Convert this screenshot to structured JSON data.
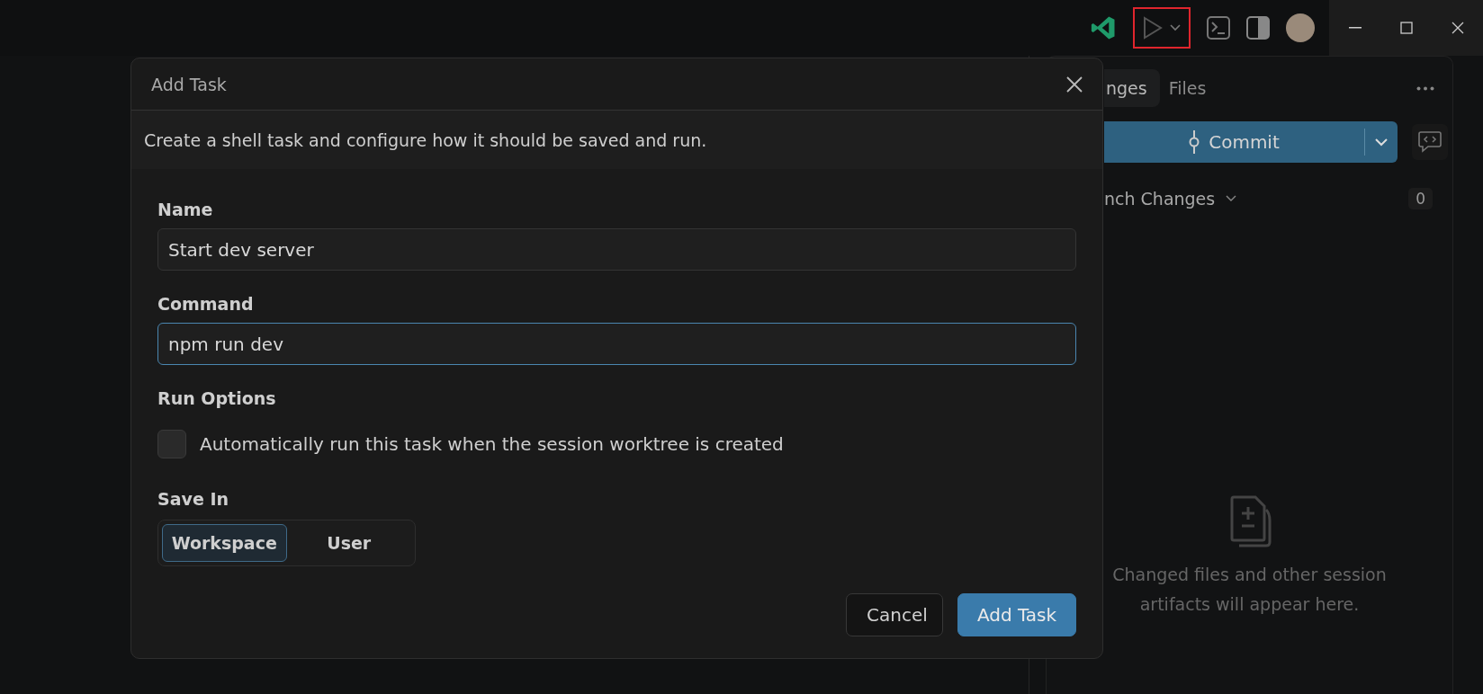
{
  "titlebar": {
    "run_button": {
      "annotated": true
    }
  },
  "panel": {
    "tabs": [
      {
        "label": "nges",
        "selected": true
      },
      {
        "label": "Files",
        "selected": false
      }
    ],
    "commit_button": {
      "label": "Commit"
    },
    "section": {
      "label": "nch Changes",
      "count": "0",
      "expanded": true
    },
    "empty_state": {
      "text": "Changed files and other session artifacts will appear here."
    }
  },
  "dialog": {
    "title": "Add Task",
    "description": "Create a shell task and configure how it should be saved and run.",
    "fields": [
      {
        "label": "Name",
        "value": "Start dev server",
        "focused": false
      },
      {
        "label": "Command",
        "value": "npm run dev",
        "focused": true
      }
    ],
    "run_options": {
      "label": "Run Options",
      "checkbox": {
        "label": "Automatically run this task when the session worktree is created",
        "checked": false
      }
    },
    "save_in": {
      "label": "Save In",
      "options": [
        {
          "label": "Workspace",
          "selected": true
        },
        {
          "label": "User",
          "selected": false
        }
      ]
    },
    "buttons": [
      {
        "label": "Cancel",
        "kind": "secondary"
      },
      {
        "label": "Add Task",
        "kind": "primary"
      }
    ]
  }
}
